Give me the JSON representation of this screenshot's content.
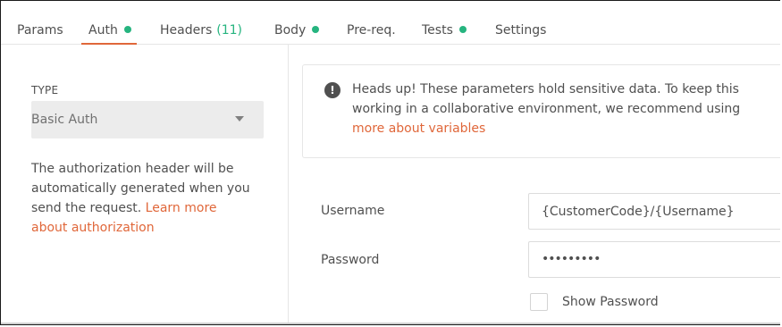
{
  "tabs": [
    {
      "label": "Params",
      "dot": false,
      "count": ""
    },
    {
      "label": "Auth",
      "dot": true,
      "count": "",
      "active": true
    },
    {
      "label": "Headers",
      "dot": false,
      "count": "(11)"
    },
    {
      "label": "Body",
      "dot": true,
      "count": ""
    },
    {
      "label": "Pre-req.",
      "dot": false,
      "count": ""
    },
    {
      "label": "Tests",
      "dot": true,
      "count": ""
    },
    {
      "label": "Settings",
      "dot": false,
      "count": ""
    }
  ],
  "auth": {
    "type_label": "TYPE",
    "type_value": "Basic Auth",
    "description": "The authorization header will be automatically generated when you send the request. ",
    "learn_link": "Learn more about authorization"
  },
  "alert": {
    "icon": "!",
    "line1": "Heads up! These parameters hold sensitive data. To keep this",
    "line2": "working in a collaborative environment, we recommend using",
    "link": "more about variables"
  },
  "form": {
    "username_label": "Username",
    "username_value": "{CustomerCode}/{Username}",
    "password_label": "Password",
    "password_value": "•••••••••",
    "show_password_label": "Show Password"
  },
  "colors": {
    "accent": "#e0673a",
    "dot": "#26b47f",
    "count": "#26b47f"
  }
}
